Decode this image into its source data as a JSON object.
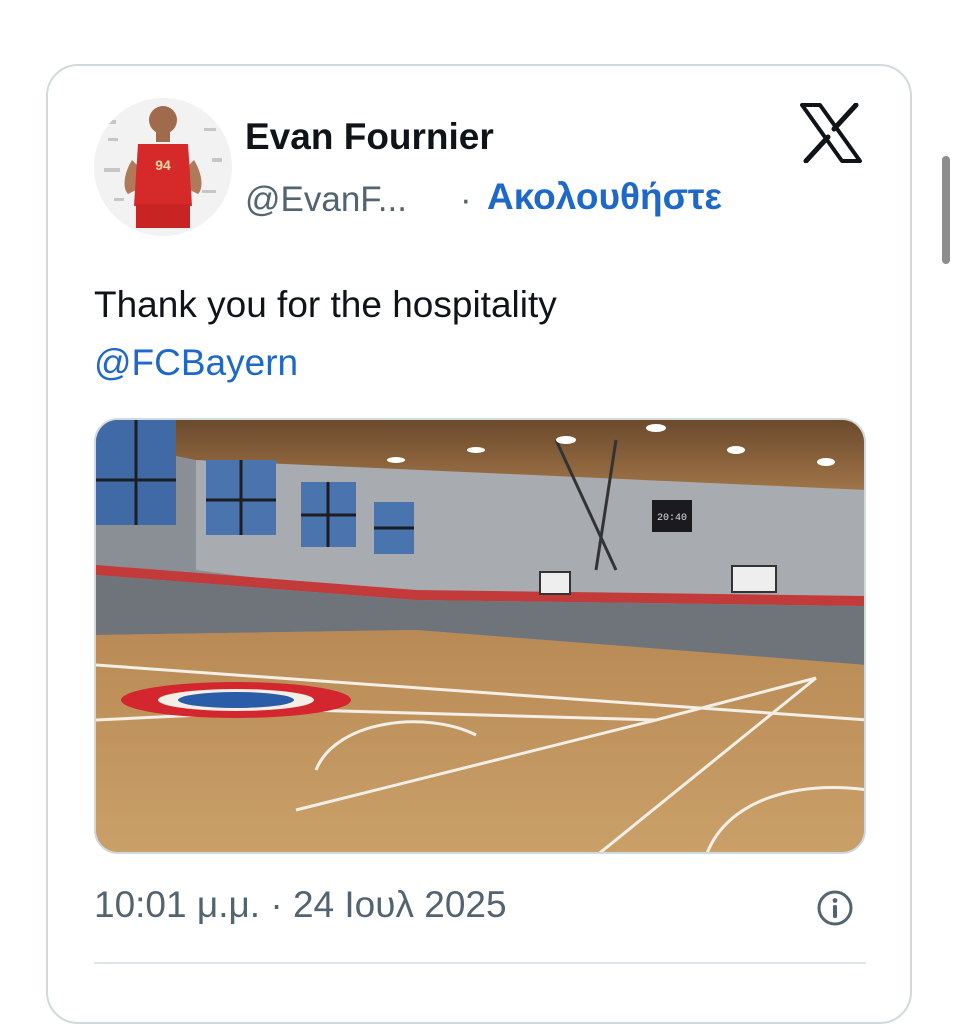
{
  "tweet": {
    "author_name": "Evan Fournier",
    "author_handle": "@EvanF...",
    "separator": "·",
    "follow_label": "Ακολουθήστε",
    "text": "Thank you for the hospitality",
    "mention": "@FCBayern",
    "timestamp": "10:01 μ.μ. · 24 Ιουλ 2025",
    "avatar_jersey_number": "94",
    "media_scoreboard_text": "20:40"
  },
  "icons": {
    "brand": "x-logo-icon",
    "info": "info-icon"
  },
  "colors": {
    "link": "#1d68c9",
    "text": "#0f1419",
    "secondary": "#536471",
    "border": "#cfd9de"
  }
}
